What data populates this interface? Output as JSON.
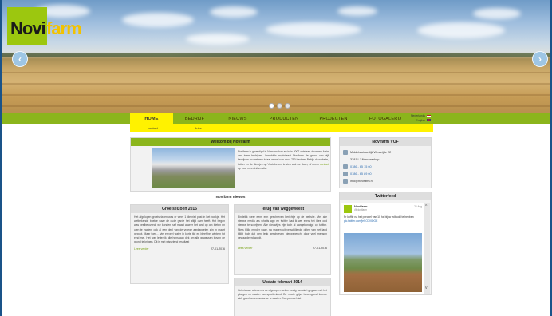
{
  "logo": {
    "part1": "Novi",
    "part2": "farm"
  },
  "slider": {
    "prev": "‹",
    "next": "›",
    "dots": 3
  },
  "nav": {
    "items": [
      "HOME",
      "BEDRIJF",
      "NIEUWS",
      "PRODUCTEN",
      "PROJECTEN",
      "FOTOGALERIJ"
    ],
    "active": 0
  },
  "lang": {
    "nl": "Nederlands",
    "en": "English"
  },
  "subnav": [
    "contact",
    "links"
  ],
  "welcome": {
    "title": "Welkom bij Novifarm",
    "text": "Novifarm is gevestigd in Numansdorp en is in 2007 ontstaan door een fusie van twee bedrijven. Inmiddels exploiteert Novifarm de grond van vijf bedrijven en met een totaal areaal van circa 750 hectare. Bekijk de website, twitter en de filmpjes op Youtube om te zien wat we doen, of neem",
    "link": "contact",
    "tail": "op voor meer informatie."
  },
  "contact": {
    "title": "Novifarm VOF",
    "address1": "Middelsluissedijk Westzijde 22",
    "address2": "3281 LJ Numansdorp",
    "phone": "0186 - 65 15 60",
    "fax": "0186 - 65 89 60",
    "email": "info@novifarm.nl"
  },
  "news": {
    "heading": "Novifarm nieuws",
    "items": [
      {
        "title": "Groeiseizoen 2015",
        "text": "Het afgelopen groeiseizoen was er weer 1 die niet past in het boekje. Het wetbekende boekje waar de oude garde het altijd over heeft. Het begon was veelbelovend, we konden half maart alweer het land op om bieten en uien te zaaien, ook al een deel van de vroege aardappelen zijn in maart gepoot. Maar toen… viel er veel water in korte tijd en bleef het wintern tot eind mei. Het was letterlijk alle hens aan dek om alle gewassen boven de grond te krijgen. Dit is met wisselend resultaat",
        "more": "Lees verder",
        "date": "27-01-2016"
      },
      {
        "title": "Terug van weggeweest",
        "text": "Eindelijk weer eens een geschreven berichtje op de website. Met alle nieuwe media als whatts app en twitter had ik wel eens het idee oud nieuws te schrijven. Alle nieuwtjes zijn toch al aangekondigd op twitter. Niets blijkt minder waar, na vragen uit verschillende delen van het land blijkt toch dat een leuk geschreven nieuwsbericht door veel mensen gewaardeerd wordt.",
        "more": "Lees verder",
        "date": "27-01-2016"
      },
      {
        "title": "Update februari 2014",
        "text": "Het nieuwe seizoen is de afgelopen weken rustig van start gegaan met het ploegen en zaaien van spruitenland. De mooie grijze bovengrond leende zich goed om zomertarwe te zaaien. Een perceel dat"
      }
    ]
  },
  "twitter": {
    "title": "Twitterfeed",
    "name": "Novifarm",
    "handle": "@Novifarm",
    "date": "26 Aug",
    "text": "Pr koffie na het perceel van 10 ha bijna volbodd te hebben",
    "link": "pic.twitter.com/jeSO7VIDGE"
  },
  "colors": {
    "green": "#8bb51c",
    "yellow": "#fff200",
    "frame": "#1e5e96"
  }
}
